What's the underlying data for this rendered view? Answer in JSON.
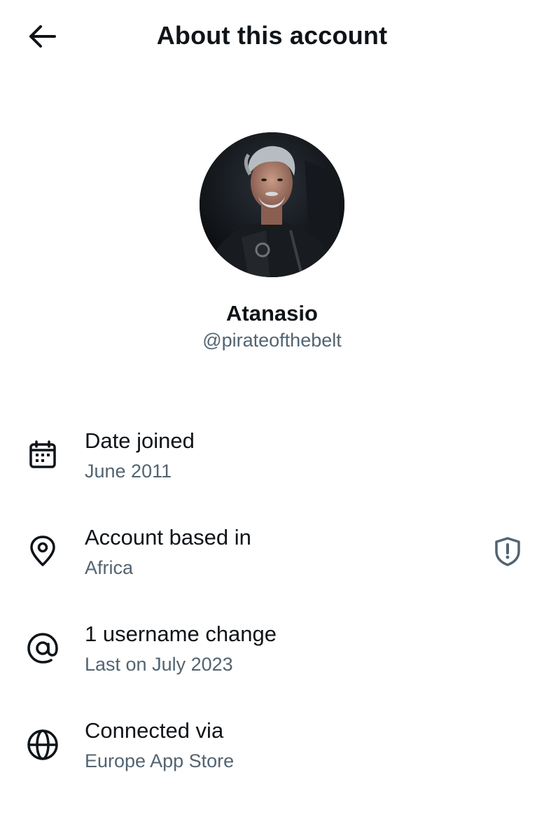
{
  "header": {
    "title": "About this account",
    "back_icon": "arrow-left-icon"
  },
  "profile": {
    "display_name": "Atanasio",
    "handle": "@pirateofthebelt",
    "avatar": "profile-photo"
  },
  "info_rows": [
    {
      "icon": "calendar-icon",
      "label": "Date joined",
      "value": "June 2011"
    },
    {
      "icon": "location-pin-icon",
      "label": "Account based in",
      "value": "Africa",
      "action_icon": "shield-alert-icon"
    },
    {
      "icon": "at-sign-icon",
      "label": "1 username change",
      "value": "Last on July 2023"
    },
    {
      "icon": "globe-icon",
      "label": "Connected via",
      "value": "Europe App Store"
    }
  ],
  "colors": {
    "text_primary": "#0f1419",
    "text_secondary": "#536471",
    "background": "#ffffff"
  }
}
